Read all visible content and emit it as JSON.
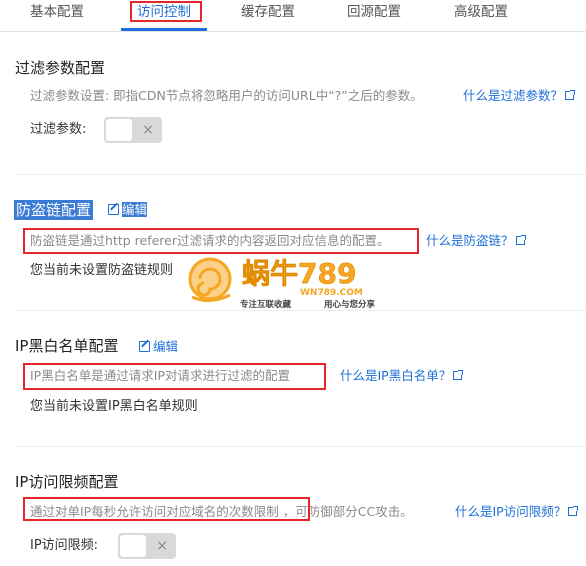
{
  "tabs": [
    {
      "label": "基本配置"
    },
    {
      "label": "访问控制"
    },
    {
      "label": "缓存配置"
    },
    {
      "label": "回源配置"
    },
    {
      "label": "高级配置"
    }
  ],
  "filter": {
    "title": "过滤参数配置",
    "desc": "过滤参数设置: 即指CDN节点将忽略用户的访问URL中“?”之后的参数。",
    "link": "什么是过滤参数？",
    "field_label": "过滤参数:",
    "toggle_icon": "×"
  },
  "referer": {
    "title": "防盗链配置",
    "edit_label": "编辑",
    "desc": "防盗链是通过http referer过滤请求的内容返回对应信息的配置。",
    "link": "什么是防盗链？",
    "empty": "您当前未设置防盗链规则"
  },
  "ip_black": {
    "title": "IP黑白名单配置",
    "edit_label": "编辑",
    "desc": "IP黑白名单是通过请求IP对请求进行过滤的配置",
    "link": "什么是IP黑白名单？",
    "empty": "您当前未设置IP黑白名单规则"
  },
  "ip_freq": {
    "title": "IP访问限频配置",
    "desc": "通过对单IP每秒允许访问对应域名的次数限制",
    "desc_tail": "，可防御部分CC攻击。",
    "link": "什么是IP访问限频？",
    "field_label": "IP访问限频:",
    "toggle_icon": "×"
  },
  "watermark": {
    "brand": "蜗牛789",
    "domain": "WN789.COM",
    "slogan_left": "专注互联收藏",
    "slogan_right": "用心与您分享"
  },
  "colors": {
    "accent": "#1e6fd9",
    "annotation_red": "#e5262b",
    "selection_blue": "#3a7bd5",
    "watermark_orange": "#f5a623"
  }
}
